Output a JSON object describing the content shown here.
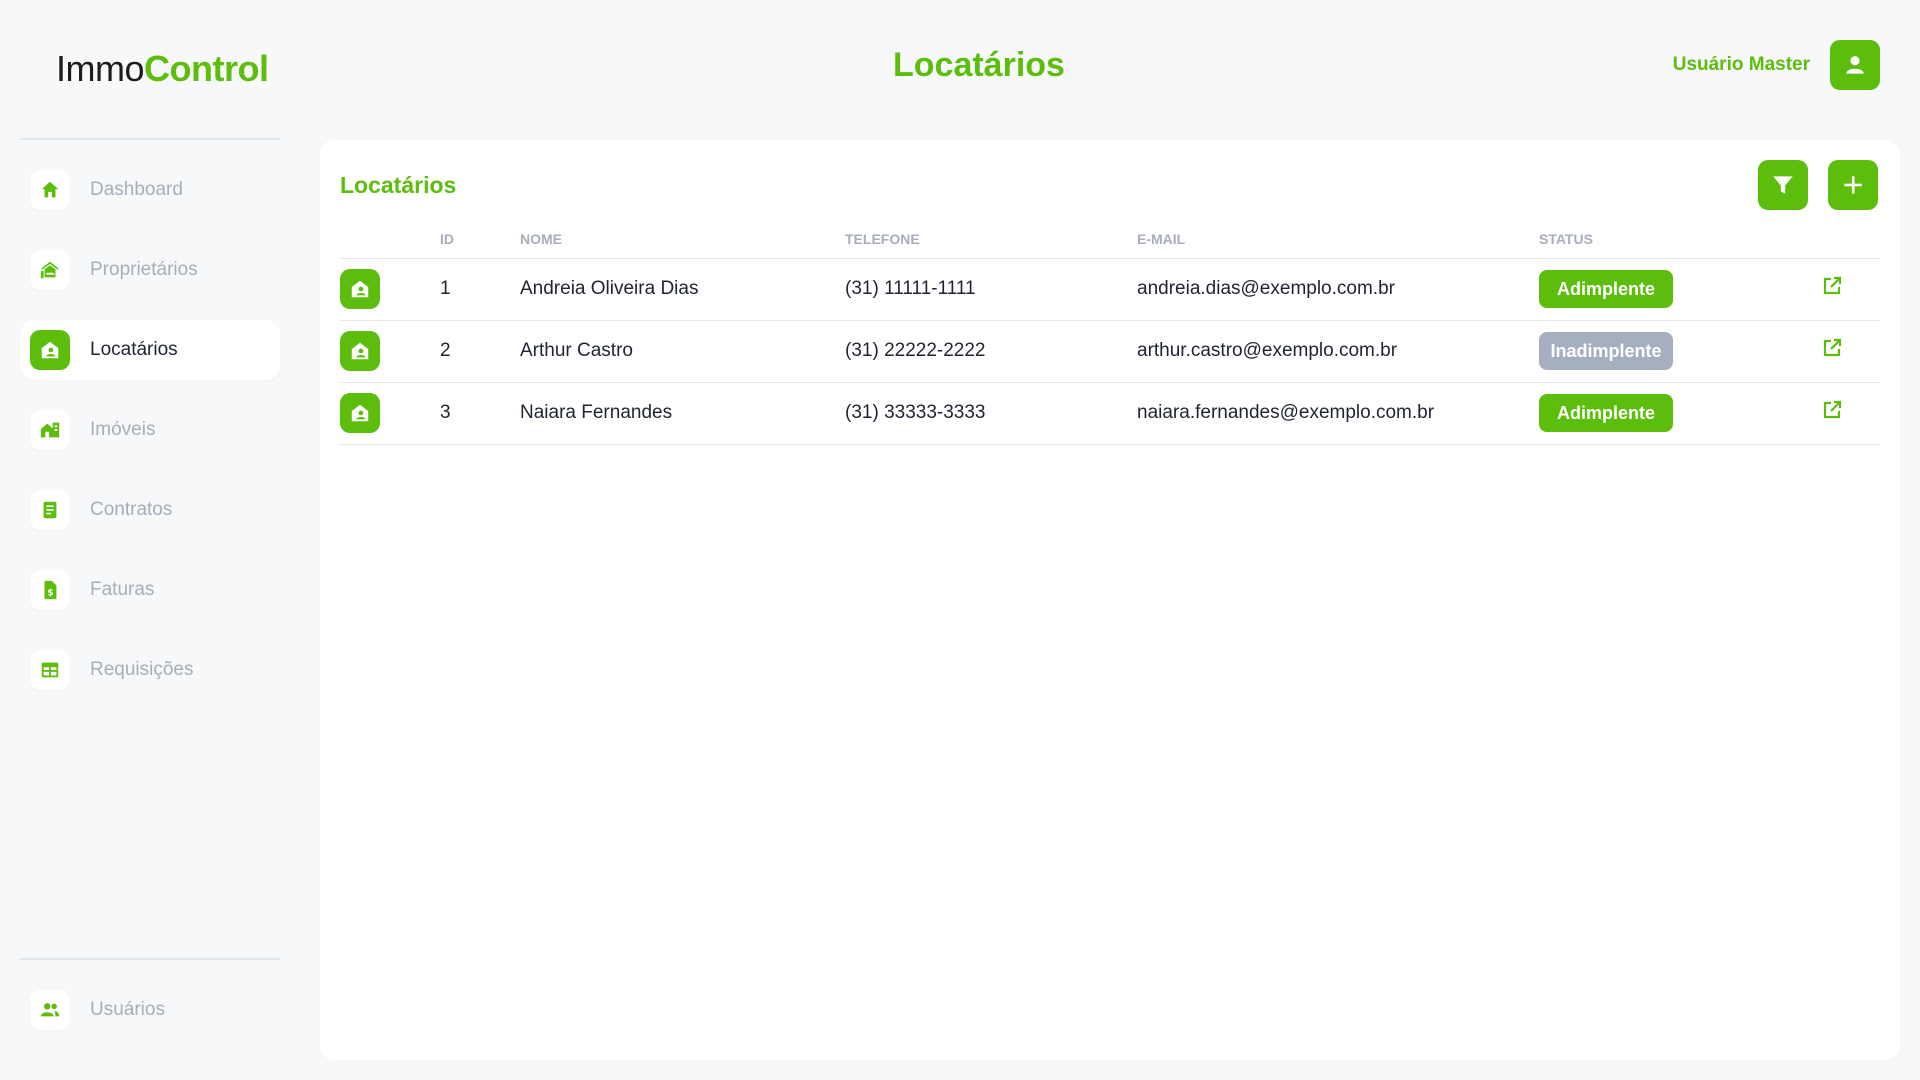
{
  "app": {
    "logo_part1": "Immo",
    "logo_part2": "Control",
    "page_title": "Locatários",
    "accent_color": "#5cbd0d",
    "muted_color": "#a5afc0"
  },
  "user": {
    "name": "Usuário Master",
    "icon": "user-icon"
  },
  "sidebar": {
    "items": [
      {
        "label": "Dashboard",
        "icon": "home-icon",
        "active": false
      },
      {
        "label": "Proprietários",
        "icon": "owner-house-icon",
        "active": false
      },
      {
        "label": "Locatários",
        "icon": "tenant-house-icon",
        "active": true
      },
      {
        "label": "Imóveis",
        "icon": "buildings-icon",
        "active": false
      },
      {
        "label": "Contratos",
        "icon": "contract-icon",
        "active": false
      },
      {
        "label": "Faturas",
        "icon": "invoice-icon",
        "active": false
      },
      {
        "label": "Requisições",
        "icon": "requests-table-icon",
        "active": false
      }
    ],
    "bottom_item": {
      "label": "Usuários",
      "icon": "users-icon"
    }
  },
  "card": {
    "title": "Locatários",
    "filter_icon": "filter-icon",
    "add_icon": "plus-icon"
  },
  "table": {
    "columns": [
      "",
      "ID",
      "NOME",
      "TELEFONE",
      "E-MAIL",
      "STATUS",
      ""
    ],
    "rows": [
      {
        "id": "1",
        "name": "Andreia Oliveira Dias",
        "phone": "(31) 11111-1111",
        "email": "andreia.dias@exemplo.com.br",
        "status": "Adimplente"
      },
      {
        "id": "2",
        "name": "Arthur Castro",
        "phone": "(31) 22222-2222",
        "email": "arthur.castro@exemplo.com.br",
        "status": "Inadimplente"
      },
      {
        "id": "3",
        "name": "Naiara Fernandes",
        "phone": "(31) 33333-3333",
        "email": "naiara.fernandes@exemplo.com.br",
        "status": "Adimplente"
      }
    ],
    "row_icon": "tenant-house-icon",
    "open_icon": "open-external-icon"
  }
}
